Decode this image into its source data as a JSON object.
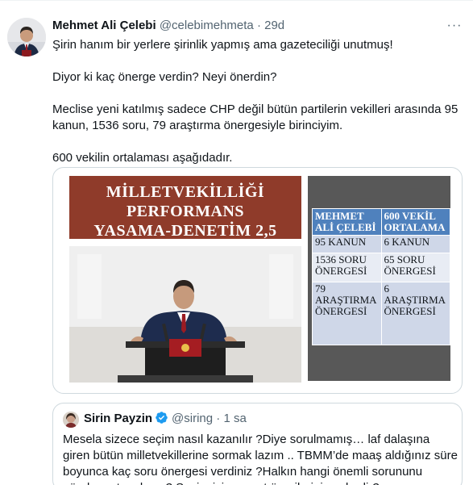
{
  "tweet": {
    "author_name": "Mehmet Ali Çelebi",
    "author_handle": "@celebimehmeta",
    "separator": "·",
    "timestamp": "29d",
    "more_label": "···",
    "paragraphs": [
      "Şirin hanım bir yerlere şirinlik yapmış ama gazeteciliği unutmuş!",
      "Diyor ki kaç önerge verdin? Neyi önerdin?",
      "Meclise yeni katılmış sadece CHP değil bütün partilerin vekilleri arasında 95 kanun, 1536 soru, 79 araştırma önergesiyle birinciyim.",
      "600 vekilin ortalaması aşağıdadır."
    ]
  },
  "media": {
    "title_lines": [
      "MİLLETVEKİLLİĞİ",
      "PERFORMANS",
      "YASAMA-DENETİM 2,5"
    ],
    "table": {
      "headers": [
        "MEHMET ALİ ÇELEBİ",
        "600 VEKİL ORTALAMA"
      ],
      "rows": [
        [
          "95 KANUN",
          "6 KANUN"
        ],
        [
          "1536 SORU ÖNERGESİ",
          "65 SORU ÖNERGESİ"
        ],
        [
          "79 ARAŞTIRMA ÖNERGESİ",
          "6 ARAŞTIRMA ÖNERGESİ"
        ]
      ]
    }
  },
  "quoted_tweet": {
    "author_name": "Sirin Payzin",
    "author_handle": "@siring",
    "separator": "·",
    "timestamp": "1 sa",
    "text": "Mesela sizece seçim nasıl kazanılır ?Diye sorulmamış… laf dalaşına giren bütün milletvekillerine sormak lazım .. TBMM’de maaş aldığınız süre boyunca kaç soru önergesi verdiniz ?Halkın hangi önemli sorununu gündeme taşıdınız ? Seçim için somut  önerileriniz nelerdir?"
  },
  "colors": {
    "title_banner": "#8f3b2a",
    "table_header": "#4f81bd",
    "table_row_dark": "#cfd7e8",
    "table_row_light": "#e8ecf4",
    "verified_badge": "#1d9bf0",
    "secondary_text": "#536471"
  },
  "icons": {
    "verified": "verified-badge-icon",
    "more": "more-options-icon"
  }
}
